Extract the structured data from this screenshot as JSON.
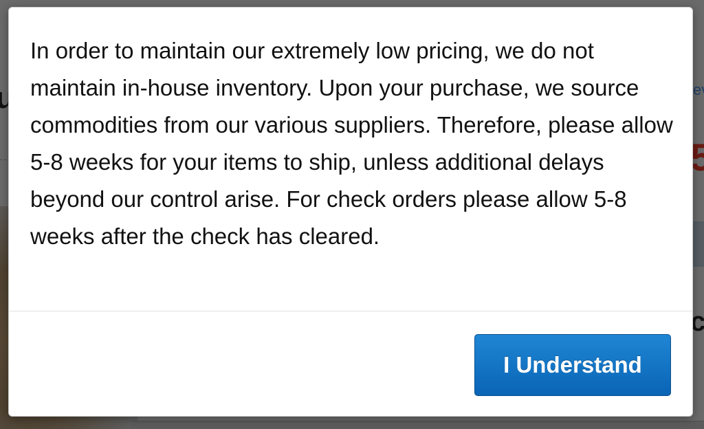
{
  "background": {
    "left_text_fragment": "u",
    "right_link_fragment": "ev",
    "right_price_fragment": "5",
    "right_heading_fragment": "c"
  },
  "modal": {
    "message": "In order to maintain our extremely low pricing, we do not maintain in-house inventory. Upon your purchase, we source commodities from our various suppliers. Therefore, please allow 5-8 weeks for your items to ship, unless additional delays beyond our control arise. For check orders please allow 5-8 weeks after the check has cleared.",
    "confirm_label": "I Understand"
  },
  "colors": {
    "button_top": "#1f86d4",
    "button_bottom": "#0a64b5",
    "overlay": "#6a6a6a"
  }
}
